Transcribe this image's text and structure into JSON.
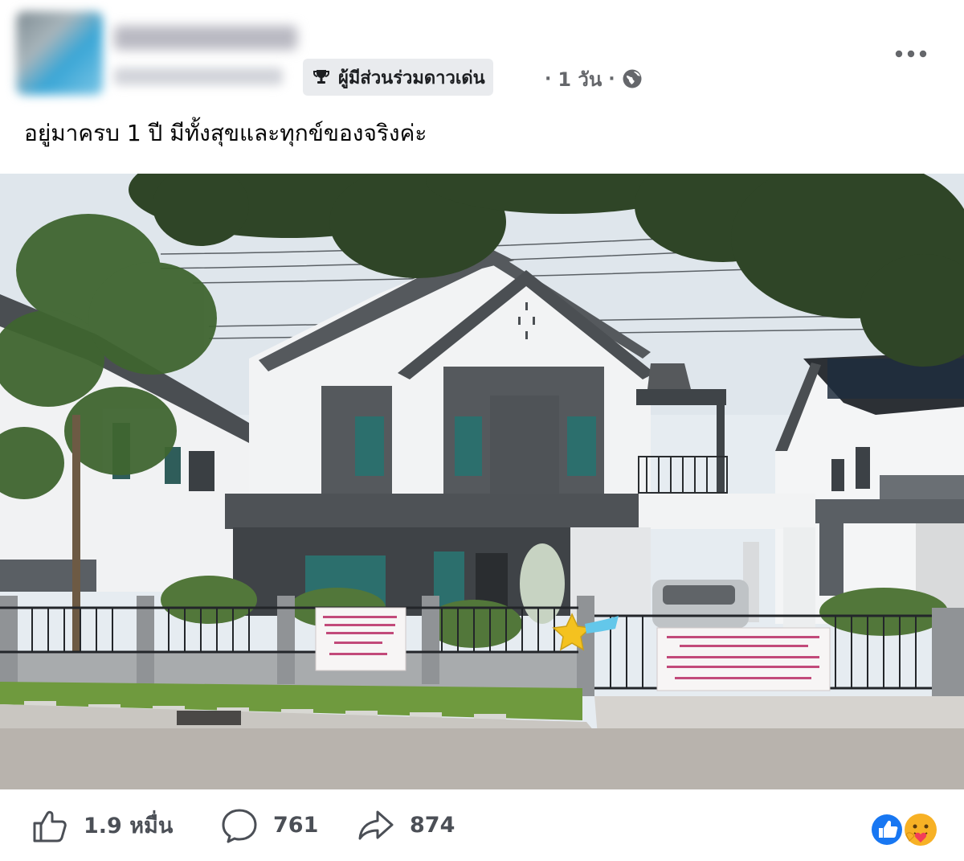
{
  "header": {
    "author_name": "",
    "author_sub": "",
    "badge": {
      "icon": "trophy-icon",
      "label": "ผู้มีส่วนร่วมดาวเด่น"
    },
    "meta": {
      "separator": "·",
      "time": "1 วัน",
      "audience_icon": "globe-icon"
    },
    "more_icon": "more-horizontal-icon"
  },
  "post": {
    "text": "อยู่มาครบ 1 ปี มีทั้งสุขและทุกข์ของจริงค่ะ"
  },
  "photo": {
    "description_icon": "house-photo",
    "colors": {
      "house_dark": "#55595d",
      "house_white": "#f2f3f4",
      "sky": "#e7edf2",
      "tree": "#2f4527",
      "grass": "#6f9a3e"
    }
  },
  "actions": {
    "like": {
      "icon": "like-thumb-icon",
      "count": "1.9 หมื่น"
    },
    "comment": {
      "icon": "comment-bubble-icon",
      "count": "761"
    },
    "share": {
      "icon": "share-arrow-icon",
      "count": "874"
    }
  },
  "reactions": [
    "like-reaction-icon",
    "care-reaction-icon"
  ],
  "colors": {
    "accent_blue": "#1877f2",
    "secondary_text": "#65676b",
    "badge_bg": "#e9ebee"
  }
}
